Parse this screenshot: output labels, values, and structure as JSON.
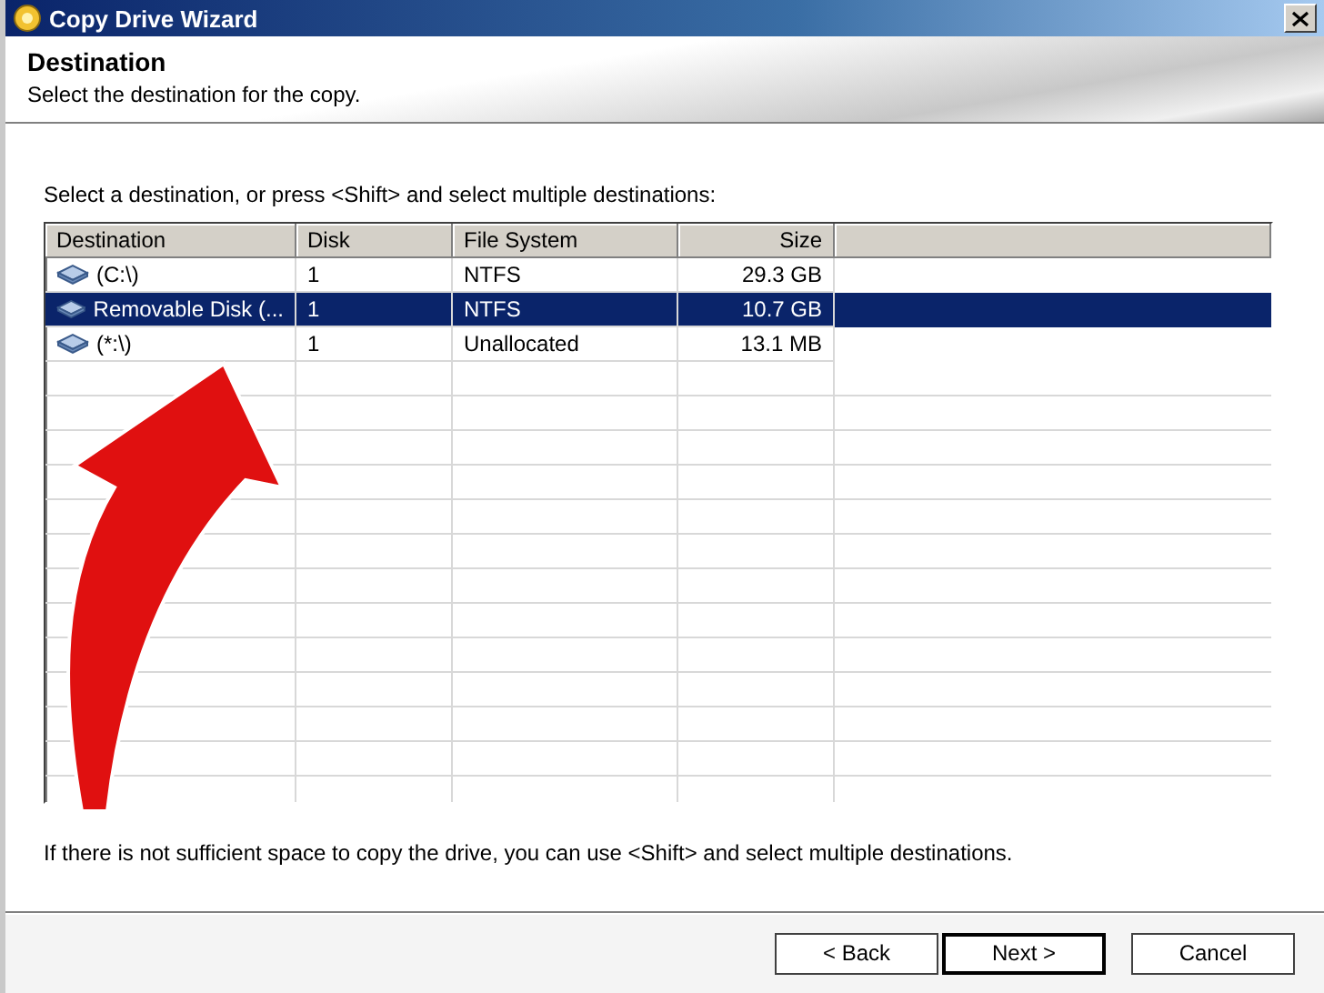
{
  "window": {
    "title": "Copy Drive Wizard"
  },
  "header": {
    "title": "Destination",
    "subtitle": "Select the destination for the copy."
  },
  "instruction": "Select a destination, or press <Shift> and select multiple destinations:",
  "table": {
    "columns": [
      "Destination",
      "Disk",
      "File System",
      "Size"
    ],
    "rows": [
      {
        "destination": "(C:\\)",
        "disk": "1",
        "file_system": "NTFS",
        "size": "29.3 GB",
        "selected": false
      },
      {
        "destination": "Removable Disk (...",
        "disk": "1",
        "file_system": "NTFS",
        "size": "10.7 GB",
        "selected": true
      },
      {
        "destination": "(*:\\)",
        "disk": "1",
        "file_system": "Unallocated",
        "size": "13.1 MB",
        "selected": false
      }
    ]
  },
  "note": "If there is not sufficient space to copy the drive, you can use <Shift> and select multiple destinations.",
  "buttons": [
    {
      "label": "< Back",
      "default": false
    },
    {
      "label": "Next >",
      "default": true
    },
    {
      "label": "Cancel",
      "default": false
    }
  ]
}
